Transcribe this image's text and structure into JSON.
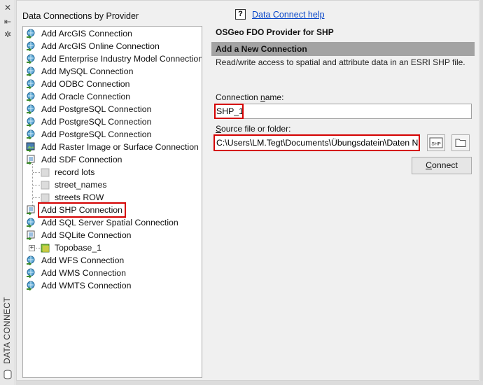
{
  "side_strip": {
    "label": "DATA CONNECT",
    "close_glyph": "✕",
    "pin_glyph": "⇤",
    "settings_glyph": "✲"
  },
  "panel": {
    "title": "Data Connections by Provider"
  },
  "tree": {
    "items": [
      {
        "label": "Add ArcGIS Connection",
        "icon": "globe-arrow-icon"
      },
      {
        "label": "Add ArcGIS Online Connection",
        "icon": "globe-arrow-icon"
      },
      {
        "label": "Add Enterprise Industry Model Connection",
        "icon": "globe-arrow-icon"
      },
      {
        "label": "Add MySQL Connection",
        "icon": "globe-arrow-icon"
      },
      {
        "label": "Add ODBC Connection",
        "icon": "globe-arrow-icon"
      },
      {
        "label": "Add Oracle Connection",
        "icon": "globe-arrow-icon"
      },
      {
        "label": "Add PostgreSQL Connection",
        "icon": "globe-arrow-icon"
      },
      {
        "label": "Add PostgreSQL Connection",
        "icon": "globe-arrow-icon"
      },
      {
        "label": "Add PostgreSQL Connection",
        "icon": "globe-arrow-icon"
      },
      {
        "label": "Add Raster Image or Surface Connection",
        "icon": "raster-icon"
      },
      {
        "label": "Add SDF Connection",
        "icon": "sdf-icon"
      },
      {
        "label": "record lots",
        "icon": "layer-icon"
      },
      {
        "label": "street_names",
        "icon": "layer-icon"
      },
      {
        "label": "streets ROW",
        "icon": "layer-icon"
      },
      {
        "label": "Add SHP Connection",
        "icon": "shp-icon"
      },
      {
        "label": "Add SQL Server Spatial Connection",
        "icon": "globe-arrow-icon"
      },
      {
        "label": "Add SQLite Connection",
        "icon": "sqlite-icon"
      },
      {
        "label": "Topobase_1",
        "icon": "topobase-icon"
      },
      {
        "label": "Add WFS Connection",
        "icon": "globe-arrow-icon"
      },
      {
        "label": "Add WMS Connection",
        "icon": "globe-arrow-icon"
      },
      {
        "label": "Add WMTS Connection",
        "icon": "globe-arrow-icon"
      }
    ]
  },
  "right": {
    "help_glyph": "?",
    "help_link": "Data Connect help",
    "provider_title": "OSGeo FDO Provider for SHP",
    "section_bar": "Add a New Connection",
    "description": "Read/write access to spatial and attribute data in an ESRI SHP file.",
    "connection_name_label_pre": "Connection ",
    "connection_name_label_u": "n",
    "connection_name_label_post": "ame:",
    "connection_name_value": "SHP_1",
    "source_label_u": "S",
    "source_label_post": "ource file or folder:",
    "source_value": "C:\\Users\\LM.Tegt\\Documents\\Übungsdatein\\Daten NI",
    "shp_button_text": "SHP",
    "connect_label_u": "C",
    "connect_label_post": "onnect"
  },
  "colors": {
    "highlight": "#d40000",
    "link": "#0645c8",
    "bar": "#a3a3a3"
  }
}
